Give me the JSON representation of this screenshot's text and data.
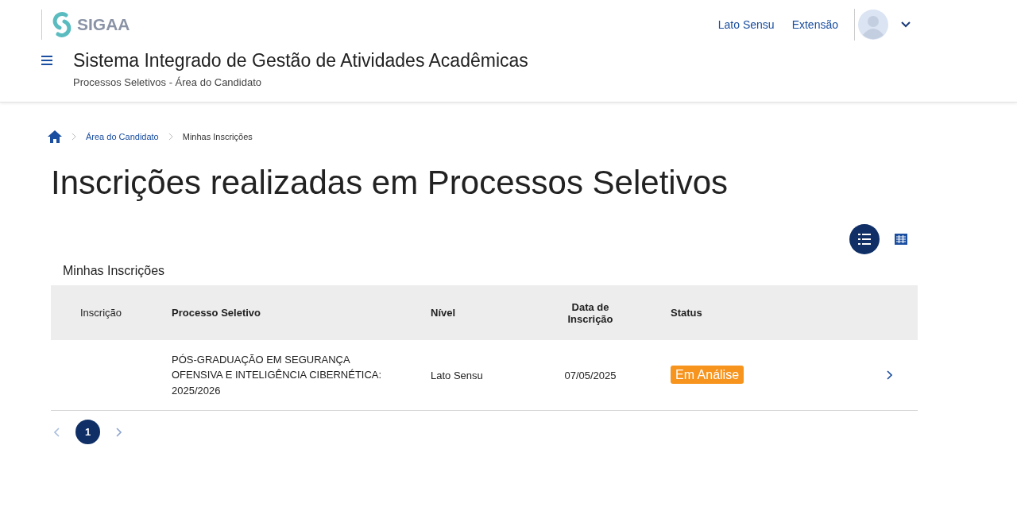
{
  "header": {
    "logo_text": "SIGAA",
    "nav_links": [
      "Lato Sensu",
      "Extensão"
    ],
    "title": "Sistema Integrado de Gestão de Atividades Acadêmicas",
    "subtitle": "Processos Seletivos - Área do Candidato"
  },
  "breadcrumb": [
    {
      "label": "Área do Candidato",
      "kind": "link"
    },
    {
      "label": "Minhas Inscrições",
      "kind": "current"
    }
  ],
  "page_title": "Inscrições realizadas em Processos Seletivos",
  "view_toggle": [
    {
      "kind": "list",
      "selected": true
    },
    {
      "kind": "grid",
      "selected": false
    }
  ],
  "table": {
    "caption": "Minhas Inscrições",
    "columns": [
      "Inscrição",
      "Processo Seletivo",
      "Nível",
      "Data de Inscrição",
      "Status"
    ],
    "rows": [
      {
        "processo": "PÓS-GRADUAÇÃO EM SEGURANÇA OFENSIVA E INTELIGÊNCIA CIBERNÉTICA: 2025/2026",
        "nivel": "Lato Sensu",
        "data": "07/05/2025",
        "status": "Em Análise",
        "color": "#f7941d"
      }
    ]
  },
  "pagination": {
    "prev_disabled": true,
    "pages": [
      {
        "label": "1",
        "selected": true
      }
    ]
  }
}
